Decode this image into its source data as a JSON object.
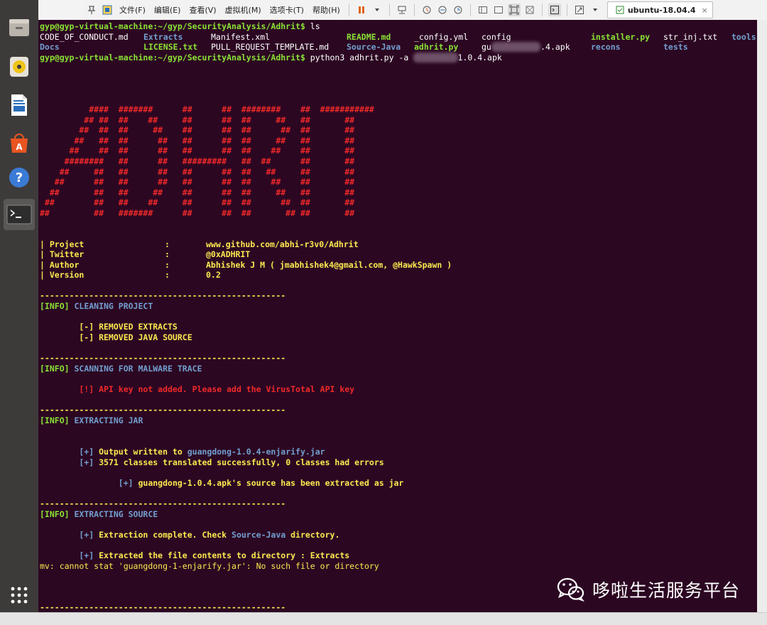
{
  "toolbar": {
    "menus": [
      "文件(F)",
      "编辑(E)",
      "查看(V)",
      "虚拟机(M)",
      "选项卡(T)",
      "帮助(H)"
    ],
    "tab_label": "ubuntu-18.04.4",
    "close_glyph": "×"
  },
  "terminal": {
    "prompt": "gyp@gyp-virtual-machine:~/gyp/SecurityAnalysis/Adhrit$",
    "cmd1": " ls",
    "ls_row1": {
      "c1": "CODE_OF_CONDUCT.md",
      "c2": "Extracts",
      "c3": "Manifest.xml",
      "c4": "README.md",
      "c5": "_config.yml",
      "c6": "config",
      "c7": "installer.py",
      "c8": "str_inj.txt",
      "c9": "tools"
    },
    "ls_row2": {
      "c1": "Docs",
      "c2": "LICENSE.txt",
      "c3": "PULL_REQUEST_TEMPLATE.md",
      "c4": "Source-Java",
      "c5": "adhrit.py",
      "c6a": "gu",
      "c6b": ".4.apk",
      "c7": "recons",
      "c8": "tests"
    },
    "cmd2a": " python3 adhrit.py -a ",
    "cmd2b": "1.0.4.apk",
    "banner": [
      "          ####  #######      ##      ##  ########    ##  ###########",
      "         ## ##  ##    ##     ##      ##  ##     ##   ##       ##",
      "        ##  ##  ##     ##    ##      ##  ##      ##  ##       ##",
      "       ##   ##  ##      ##   ##      ##  ##     ##   ##       ##",
      "      ##    ##  ##      ##   ##      ##  ##    ##    ##       ##",
      "     ########   ##      ##   #########   ##  ##      ##       ##",
      "    ##     ##   ##      ##   ##      ##  ##   ##     ##       ##",
      "   ##      ##   ##      ##   ##      ##  ##    ##    ##       ##",
      "  ##       ##   ##     ##    ##      ##  ##     ##   ##       ##",
      " ##        ##   ##    ##     ##      ##  ##      ##  ##       ##",
      "##         ##   #######      ##      ##  ##       ## ##       ##"
    ],
    "info": {
      "project_label": "| Project",
      "twitter_label": "| Twitter",
      "author_label": "| Author",
      "version_label": "| Version",
      "colon": ":",
      "project_value": "www.github.com/abhi-r3v0/Adhrit",
      "twitter_value": "@0xADHRIT",
      "author_value": "Abhishek J M ( jmabhishek4@gmail.com, @HawkSpawn )",
      "version_value": "0.2"
    },
    "divider": "--------------------------------------------------",
    "info_tag": "[INFO]",
    "sec1_title": " CLEANING PROJECT",
    "sec1_l1": "        [-] REMOVED EXTRACTS",
    "sec1_l2": "        [-] REMOVED JAVA SOURCE",
    "sec2_title": " SCANNING FOR MALWARE TRACE",
    "sec2_l1": "        [!] API key not added. Please add the VirusTotal API key",
    "sec3_title": " EXTRACTING JAR",
    "sec3_l1a": "        [+] ",
    "sec3_l1b": "Output written to ",
    "sec3_l1c": "guangdong-1.0.4-enjarify.jar",
    "sec3_l2a": "        [+] ",
    "sec3_l2b": "3571 classes translated successfully, 0 classes had errors",
    "sec3_l3a": "                [+] ",
    "sec3_l3b": "guangdong-1.0.4.apk's source has been extracted as jar",
    "sec4_title": " EXTRACTING SOURCE",
    "sec4_l1a": "        [+] ",
    "sec4_l1b": "Extraction complete. Check ",
    "sec4_l1c": "Source-Java",
    "sec4_l1d": " directory.",
    "sec4_l2a": "        [+] ",
    "sec4_l2b": "Extracted the file contents to directory : Extracts",
    "mv_error": "mv: cannot stat 'guangdong-1-enjarify.jar': No such file or directory"
  },
  "watermark": {
    "text": "哆啦生活服务平台"
  }
}
